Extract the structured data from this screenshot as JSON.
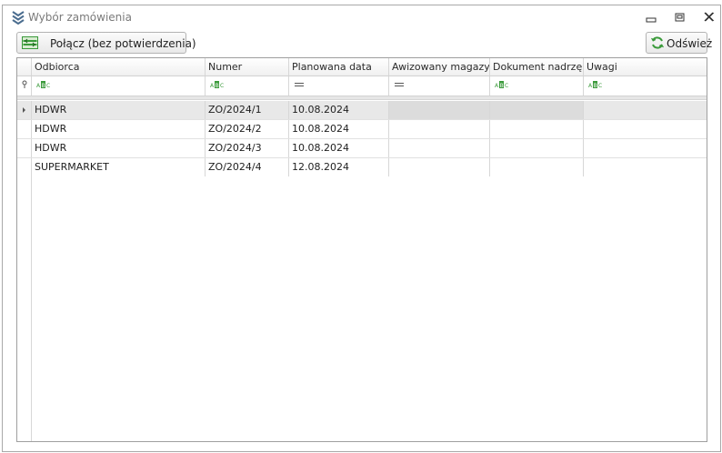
{
  "window": {
    "title": "Wybór zamówienia",
    "icon": "chevrons-down-icon",
    "minimize_icon": "minimize-icon",
    "restore_icon": "restore-icon",
    "close_icon": "close-icon"
  },
  "toolbar": {
    "connect_label": "Połącz (bez potwierdzenia)",
    "connect_icon": "table-merge-icon",
    "refresh_label": "Odśwież",
    "refresh_icon": "refresh-icon"
  },
  "grid": {
    "columns": [
      "Odbiorca",
      "Numer",
      "Planowana data",
      "Awizowany magazy…",
      "Dokument nadrzę…",
      "Uwagi"
    ],
    "filter_types": [
      "text",
      "text",
      "equals",
      "equals",
      "text",
      "text"
    ],
    "rows": [
      [
        "HDWR",
        "ZO/2024/1",
        "10.08.2024",
        "",
        "",
        ""
      ],
      [
        "HDWR",
        "ZO/2024/2",
        "10.08.2024",
        "",
        "",
        ""
      ],
      [
        "HDWR",
        "ZO/2024/3",
        "10.08.2024",
        "",
        "",
        ""
      ],
      [
        "SUPERMARKET",
        "ZO/2024/4",
        "12.08.2024",
        "",
        "",
        ""
      ]
    ],
    "selected_row": 0
  },
  "colors": {
    "accent_green": "#3a9a3a",
    "header_text": "#2a2a2a",
    "selected_row": "#e8e8e8",
    "title_text": "#7a7a7a"
  }
}
